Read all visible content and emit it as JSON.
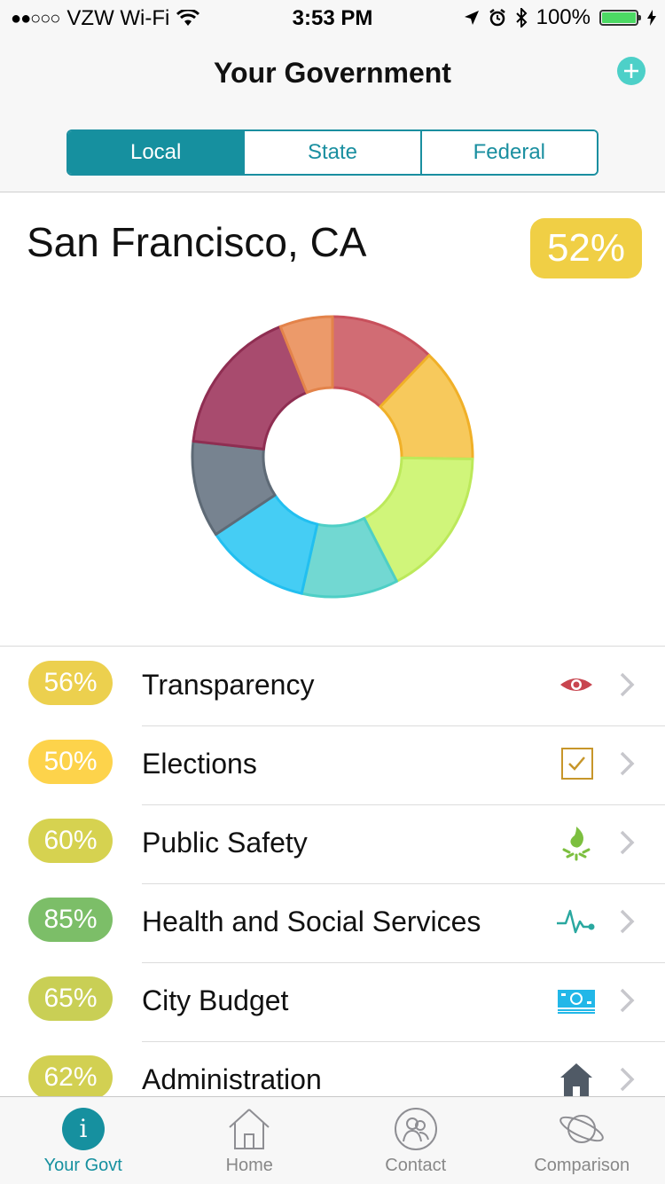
{
  "status_bar": {
    "signal": "●●○○○",
    "carrier": "VZW Wi-Fi",
    "time": "3:53 PM",
    "battery": "100%",
    "battery_level": 1.0
  },
  "header": {
    "title": "Your Government",
    "tabs": [
      {
        "label": "Local",
        "active": true
      },
      {
        "label": "State",
        "active": false
      },
      {
        "label": "Federal",
        "active": false
      }
    ]
  },
  "location": {
    "name": "San Francisco, CA",
    "score": "52%",
    "score_color": "#f0cf45"
  },
  "chart_data": {
    "type": "pie",
    "donut": true,
    "title": "",
    "slices": [
      {
        "value": 12,
        "color": "#d16c74",
        "stroke": "#c8505c"
      },
      {
        "value": 13,
        "color": "#f7c95c",
        "stroke": "#f0b028"
      },
      {
        "value": 17,
        "color": "#d0f57a",
        "stroke": "#bce95a"
      },
      {
        "value": 11,
        "color": "#72d8d2",
        "stroke": "#4ecfc6"
      },
      {
        "value": 12,
        "color": "#45cdf4",
        "stroke": "#22bff0"
      },
      {
        "value": 11,
        "color": "#778390",
        "stroke": "#5e6a76"
      },
      {
        "value": 17,
        "color": "#a84b6e",
        "stroke": "#8f2e52"
      },
      {
        "value": 6,
        "color": "#ec9a6a",
        "stroke": "#e3834a"
      }
    ]
  },
  "categories": [
    {
      "pct": "56%",
      "color": "#ecd04e",
      "label": "Transparency",
      "icon": "eye-icon"
    },
    {
      "pct": "50%",
      "color": "#fdd34b",
      "label": "Elections",
      "icon": "checkbox-icon"
    },
    {
      "pct": "60%",
      "color": "#d6d250",
      "label": "Public Safety",
      "icon": "fire-icon"
    },
    {
      "pct": "85%",
      "color": "#7cbe68",
      "label": "Health and Social Services",
      "icon": "heartbeat-icon"
    },
    {
      "pct": "65%",
      "color": "#c9cf55",
      "label": "City Budget",
      "icon": "money-icon"
    },
    {
      "pct": "62%",
      "color": "#d2d052",
      "label": "Administration",
      "icon": "house-icon"
    }
  ],
  "tab_bar": {
    "tabs": [
      {
        "label": "Your Govt",
        "icon": "info-icon",
        "active": true
      },
      {
        "label": "Home",
        "icon": "home-icon",
        "active": false
      },
      {
        "label": "Contact",
        "icon": "contact-icon",
        "active": false
      },
      {
        "label": "Comparison",
        "icon": "planet-icon",
        "active": false
      }
    ]
  }
}
